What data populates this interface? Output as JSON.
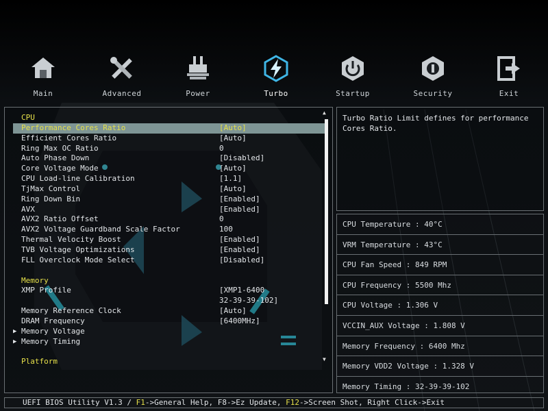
{
  "nav": {
    "items": [
      {
        "label": "Main",
        "icon": "home-icon"
      },
      {
        "label": "Advanced",
        "icon": "tools-icon"
      },
      {
        "label": "Power",
        "icon": "power-plug-icon"
      },
      {
        "label": "Turbo",
        "icon": "lightning-icon"
      },
      {
        "label": "Startup",
        "icon": "startup-icon"
      },
      {
        "label": "Security",
        "icon": "security-icon"
      },
      {
        "label": "Exit",
        "icon": "exit-icon"
      }
    ],
    "active": "Turbo"
  },
  "menu": {
    "rows": [
      {
        "k": "CPU",
        "v": "",
        "type": "section"
      },
      {
        "k": "Performance Cores Ratio",
        "v": "[Auto]",
        "type": "selected"
      },
      {
        "k": "Efficient Cores Ratio",
        "v": "[Auto]"
      },
      {
        "k": "Ring Max OC Ratio",
        "v": "0"
      },
      {
        "k": "Auto Phase Down",
        "v": "[Disabled]"
      },
      {
        "k": "Core Voltage Mode",
        "v": "[Auto]"
      },
      {
        "k": "CPU Load-line Calibration",
        "v": "[1.1]"
      },
      {
        "k": "TjMax Control",
        "v": "[Auto]"
      },
      {
        "k": "Ring Down Bin",
        "v": "[Enabled]"
      },
      {
        "k": "AVX",
        "v": "[Enabled]"
      },
      {
        "k": "AVX2 Ratio Offset",
        "v": "0"
      },
      {
        "k": "AVX2 Voltage Guardband Scale Factor",
        "v": "100"
      },
      {
        "k": "Thermal Velocity Boost",
        "v": "[Enabled]"
      },
      {
        "k": "TVB Voltage Optimizations",
        "v": "[Enabled]"
      },
      {
        "k": "FLL Overclock Mode Select",
        "v": "[Disabled]"
      },
      {
        "k": "",
        "v": "",
        "type": "blank"
      },
      {
        "k": "Memory",
        "v": "",
        "type": "section"
      },
      {
        "k": "XMP Profile",
        "v": "[XMP1-6400"
      },
      {
        "k": "",
        "v": "32-39-39-102]"
      },
      {
        "k": "Memory Reference Clock",
        "v": "[Auto]"
      },
      {
        "k": "DRAM Frequency",
        "v": "[6400MHz]"
      },
      {
        "k": "Memory Voltage",
        "v": "",
        "type": "sub"
      },
      {
        "k": "Memory Timing",
        "v": "",
        "type": "sub"
      },
      {
        "k": "",
        "v": "",
        "type": "blank"
      },
      {
        "k": "Platform",
        "v": "",
        "type": "section"
      }
    ]
  },
  "help": {
    "text": "Turbo Ratio Limit defines for performance Cores Ratio."
  },
  "hw": {
    "rows": [
      "CPU Temperature : 40°C",
      "VRM Temperature : 43°C",
      "CPU Fan Speed : 849 RPM",
      "CPU Frequency : 5500 Mhz",
      "CPU Voltage : 1.306 V",
      "VCCIN_AUX Voltage : 1.808 V",
      "Memory Frequency : 6400 Mhz",
      "Memory VDD2 Voltage : 1.328 V",
      "Memory Timing : 32-39-39-102"
    ]
  },
  "status": {
    "prefix": "UEFI BIOS Utility V1.3 / ",
    "f1": "F1",
    "f1_text": "->General Help, F8->Ez Update, ",
    "f12": "F12",
    "f12_text": "->Screen Shot, Right Click->Exit"
  }
}
